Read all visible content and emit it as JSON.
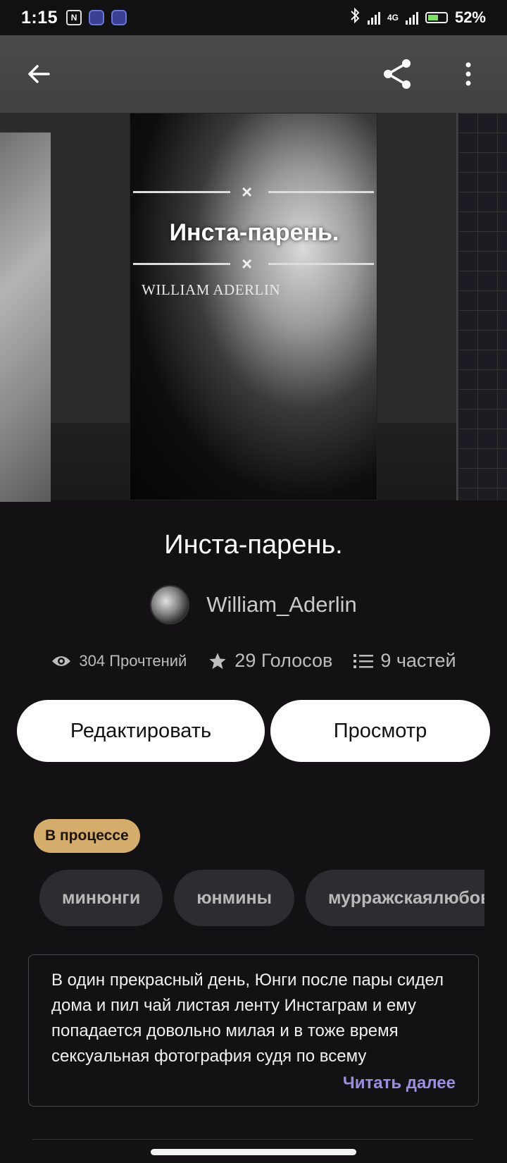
{
  "status_bar": {
    "time": "1:15",
    "network": "4G",
    "battery": "52%"
  },
  "header": {
    "back_icon": "arrow-left-icon",
    "share_icon": "share-icon",
    "more_icon": "more-vertical-icon"
  },
  "cover": {
    "title": "Инста-парень.",
    "author": "WILLIAM ADERLIN"
  },
  "story": {
    "title": "Инста-парень.",
    "author": "William_Aderlin",
    "reads": "304 Прочтений",
    "votes": "29 Голосов",
    "parts": "9 частей"
  },
  "buttons": {
    "edit": "Редактировать",
    "view": "Просмотр"
  },
  "status_badge": "В процессе",
  "tags": [
    "минюнги",
    "юнмины",
    "мурражскаялюбовь"
  ],
  "description": {
    "text": "В один прекрасный день, Юнги после пары сидел дома и пил чай листая ленту Инстаграм и ему попадается довольно милая и в тоже время сексуальная фотография судя по всему",
    "read_more": "Читать далее"
  },
  "colors": {
    "background": "#131114",
    "badge": "#d4ac6c",
    "link": "#9b8ee0"
  }
}
